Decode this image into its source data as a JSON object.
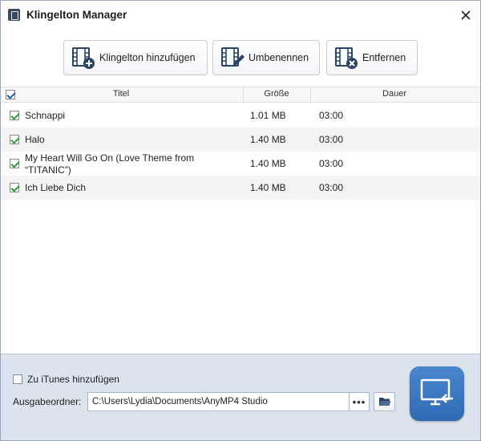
{
  "window": {
    "title": "Klingelton Manager"
  },
  "toolbar": {
    "add_label": "Klingelton hinzufügen",
    "rename_label": "Umbenennen",
    "remove_label": "Entfernen"
  },
  "table": {
    "columns": [
      "Titel",
      "Größe",
      "Dauer"
    ],
    "select_all_checked": true,
    "rows": [
      {
        "checked": true,
        "title": "Schnappi",
        "size": "1.01 MB",
        "duration": "03:00"
      },
      {
        "checked": true,
        "title": "Halo",
        "size": "1.40 MB",
        "duration": "03:00"
      },
      {
        "checked": true,
        "title_line1": "My Heart Will Go On (Love Theme from",
        "title_line2": "“TITANIC”)",
        "size": "1.40 MB",
        "duration": "03:00"
      },
      {
        "checked": true,
        "title": "Ich Liebe Dich",
        "size": "1.40 MB",
        "duration": "03:00"
      }
    ]
  },
  "bottom": {
    "itunes_label": "Zu iTunes hinzufügen",
    "itunes_checked": false,
    "output_label": "Ausgabeordner:",
    "output_path": "C:\\Users\\Lydia\\Documents\\AnyMP4 Studio",
    "browse_label": "•••"
  },
  "icons": {
    "app": "app-icon",
    "close": "close-icon",
    "add": "film-add-icon",
    "rename": "film-edit-icon",
    "remove": "film-remove-icon",
    "folder": "folder-open-icon",
    "export": "export-to-device-icon"
  },
  "colors": {
    "check_green": "#2e9a3a",
    "panel_bg": "#dbe3ee",
    "export_blue": "#3a78c2",
    "icon_navy": "#2c4566"
  }
}
